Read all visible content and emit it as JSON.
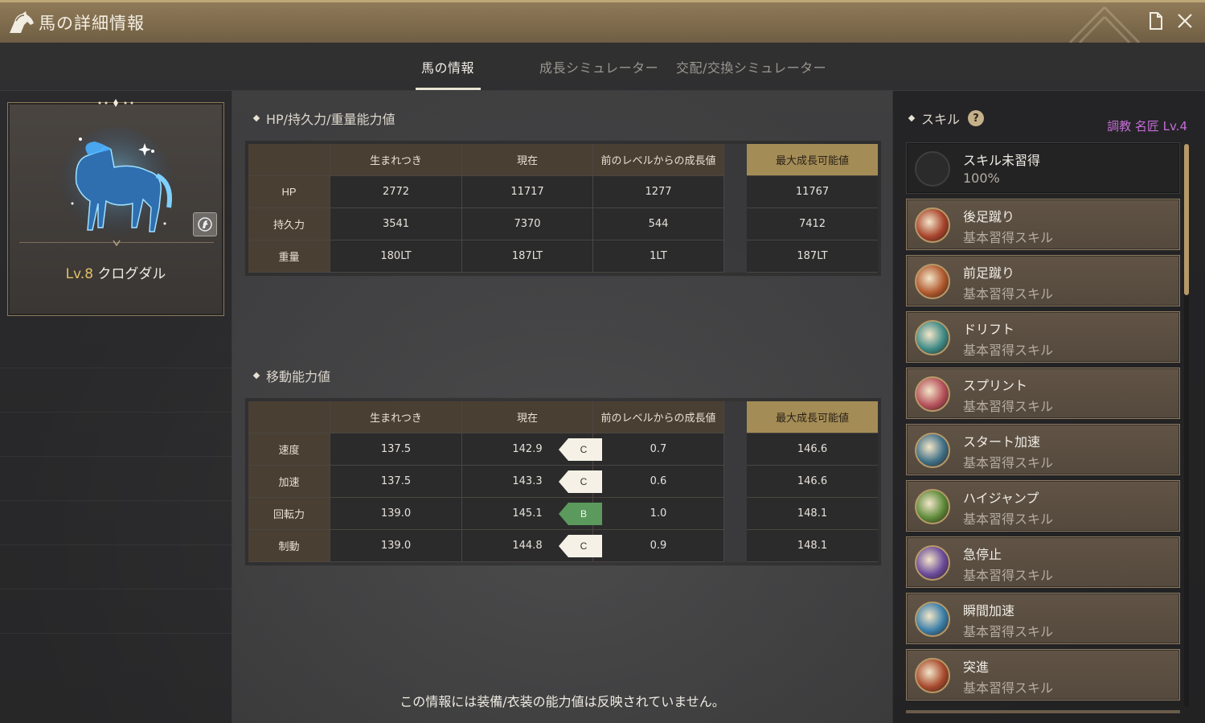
{
  "window": {
    "title": "馬の詳細情報"
  },
  "tabs": [
    {
      "label": "馬の情報",
      "active": true
    },
    {
      "label": "成長シミュレーター",
      "active": false
    },
    {
      "label": "交配/交換シミュレーター",
      "active": false
    }
  ],
  "horse": {
    "level": "Lv.8",
    "name": "クログダル"
  },
  "hp_section": {
    "title": "HP/持久力/重量能力値",
    "columns": [
      "生まれつき",
      "現在",
      "前のレベルからの成長値",
      "最大成長可能値"
    ],
    "rows": [
      {
        "label": "HP",
        "innate": "2772",
        "current": "11717",
        "growth": "1277",
        "max": "11767"
      },
      {
        "label": "持久力",
        "innate": "3541",
        "current": "7370",
        "growth": "544",
        "max": "7412"
      },
      {
        "label": "重量",
        "innate": "180LT",
        "current": "187LT",
        "growth": "1LT",
        "max": "187LT"
      }
    ]
  },
  "move_section": {
    "title": "移動能力値",
    "columns": [
      "生まれつき",
      "現在",
      "前のレベルからの成長値",
      "最大成長可能値"
    ],
    "rows": [
      {
        "label": "速度",
        "innate": "137.5",
        "current": "142.9",
        "grade": "C",
        "growth": "0.7",
        "max": "146.6"
      },
      {
        "label": "加速",
        "innate": "137.5",
        "current": "143.3",
        "grade": "C",
        "growth": "0.6",
        "max": "146.6"
      },
      {
        "label": "回転力",
        "innate": "139.0",
        "current": "145.1",
        "grade": "B",
        "growth": "1.0",
        "max": "148.1"
      },
      {
        "label": "制動",
        "innate": "139.0",
        "current": "144.8",
        "grade": "C",
        "growth": "0.9",
        "max": "148.1"
      }
    ]
  },
  "footer_note": "この情報には装備/衣装の能力値は反映されていません。",
  "skills": {
    "title": "スキル",
    "trainer": "調教 名匠 Lv.4",
    "items": [
      {
        "name": "スキル未習得",
        "sub": "100%",
        "empty": true,
        "icon": "empty-slot-icon",
        "color": "#2b2b2c"
      },
      {
        "name": "後足蹴り",
        "sub": "基本習得スキル",
        "icon": "back-kick-icon",
        "color": "#a8432c"
      },
      {
        "name": "前足蹴り",
        "sub": "基本習得スキル",
        "icon": "front-kick-icon",
        "color": "#b0582e"
      },
      {
        "name": "ドリフト",
        "sub": "基本習得スキル",
        "icon": "drift-icon",
        "color": "#3e8a86"
      },
      {
        "name": "スプリント",
        "sub": "基本習得スキル",
        "icon": "sprint-icon",
        "color": "#b5505a"
      },
      {
        "name": "スタート加速",
        "sub": "基本習得スキル",
        "icon": "start-accel-icon",
        "color": "#3f6f86"
      },
      {
        "name": "ハイジャンプ",
        "sub": "基本習得スキル",
        "icon": "high-jump-icon",
        "color": "#5d8a3a"
      },
      {
        "name": "急停止",
        "sub": "基本習得スキル",
        "icon": "sudden-stop-icon",
        "color": "#6a4a9a"
      },
      {
        "name": "瞬間加速",
        "sub": "基本習得スキル",
        "icon": "instant-accel-icon",
        "color": "#3a7ea8"
      },
      {
        "name": "突進",
        "sub": "基本習得スキル",
        "icon": "charge-icon",
        "color": "#a84a2e"
      }
    ]
  },
  "colors": {
    "accent_gold": "#a48c56",
    "grade_c": "#f5f1e6",
    "grade_b": "#5b9a5c",
    "trainer_purple": "#c46dd6"
  }
}
